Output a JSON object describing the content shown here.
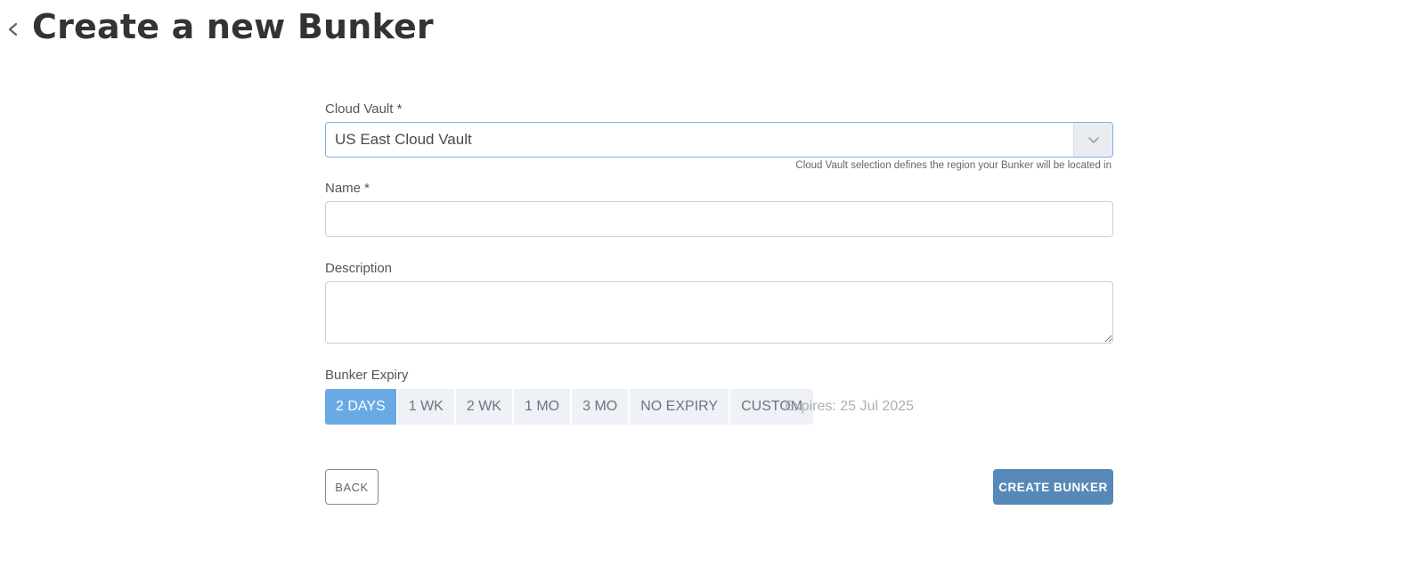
{
  "header": {
    "title": "Create a new Bunker",
    "back_icon": "chevron-left-icon"
  },
  "form": {
    "cloud_vault": {
      "label": "Cloud Vault *",
      "value": "US East Cloud Vault",
      "caret_icon": "chevron-down-icon",
      "hint": "Cloud Vault selection defines the region your Bunker will be located in"
    },
    "name": {
      "label": "Name *",
      "value": "",
      "placeholder": ""
    },
    "description": {
      "label": "Description",
      "value": "",
      "placeholder": ""
    },
    "expiry": {
      "label": "Bunker Expiry",
      "options": [
        "2 DAYS",
        "1 WK",
        "2 WK",
        "1 MO",
        "3 MO",
        "NO EXPIRY",
        "CUSTOM"
      ],
      "selected": "2 DAYS",
      "expires_text": "Expires: 25 Jul 2025"
    },
    "buttons": {
      "back_label": "BACK",
      "create_label": "CREATE BUNKER"
    }
  },
  "colors": {
    "accent": "#6aaae4",
    "primary_button": "#5689b8",
    "focus_border": "#7fb0e0"
  }
}
